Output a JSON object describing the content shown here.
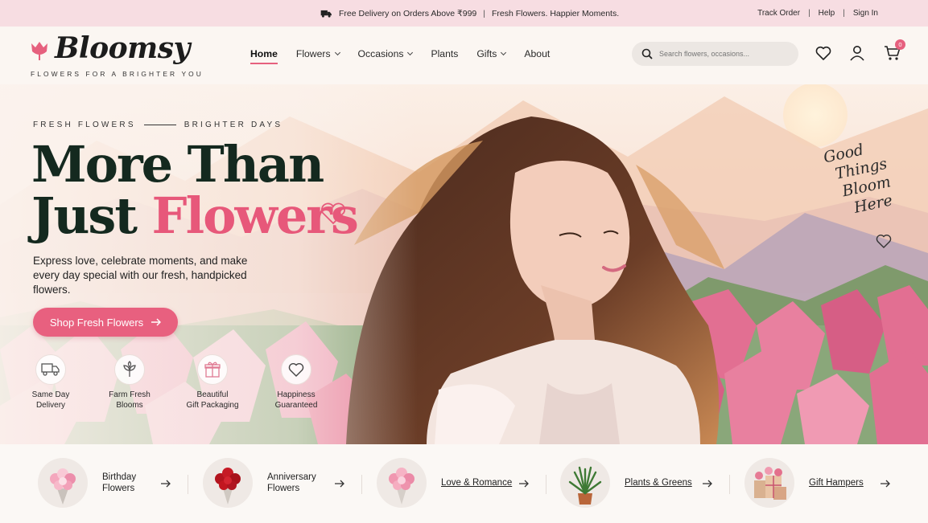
{
  "promo": {
    "delivery": "Free Delivery on Orders Above ₹999",
    "tagline": "Fresh Flowers. Happier Moments.",
    "links": [
      "Track Order",
      "Help",
      "Sign In"
    ]
  },
  "brand": {
    "name": "Bloomsy",
    "tagline": "FLOWERS FOR A BRIGHTER YOU"
  },
  "nav": [
    {
      "label": "Home",
      "active": true,
      "dropdown": false
    },
    {
      "label": "Flowers",
      "dropdown": true
    },
    {
      "label": "Occasions",
      "dropdown": true
    },
    {
      "label": "Plants",
      "dropdown": false
    },
    {
      "label": "Gifts",
      "dropdown": true
    },
    {
      "label": "About",
      "dropdown": false
    }
  ],
  "search": {
    "placeholder": "Search flowers, occasions..."
  },
  "cart": {
    "count": "0"
  },
  "hero": {
    "eyebrow_left": "FRESH FLOWERS",
    "eyebrow_right": "BRIGHTER DAYS",
    "title_line1": "More Than",
    "title_line2a": "Just ",
    "title_line2b": "Flowers",
    "subcopy": "Express love, celebrate moments, and make every day special with our fresh, handpicked flowers.",
    "cta": "Shop Fresh Flowers",
    "script_lines": [
      "Good",
      "Things",
      "Bloom",
      "Here"
    ]
  },
  "features": [
    {
      "icon": "truck-icon",
      "line1": "Same Day",
      "line2": "Delivery"
    },
    {
      "icon": "sprout-icon",
      "line1": "Farm Fresh",
      "line2": "Blooms"
    },
    {
      "icon": "gift-icon",
      "line1": "Beautiful",
      "line2": "Gift Packaging"
    },
    {
      "icon": "heart-icon",
      "line1": "Happiness",
      "line2": "Guaranteed"
    }
  ],
  "categories": [
    {
      "line1": "Birthday",
      "line2": "Flowers"
    },
    {
      "line1": "Anniversary",
      "line2": "Flowers"
    },
    {
      "line1": "Love & Romance",
      "line2": ""
    },
    {
      "line1": "Plants & Greens",
      "line2": ""
    },
    {
      "line1": "Gift Hampers",
      "line2": ""
    }
  ],
  "colors": {
    "accent": "#e8607f",
    "dark_green": "#14291f",
    "promo_bg": "#f7dde2"
  }
}
